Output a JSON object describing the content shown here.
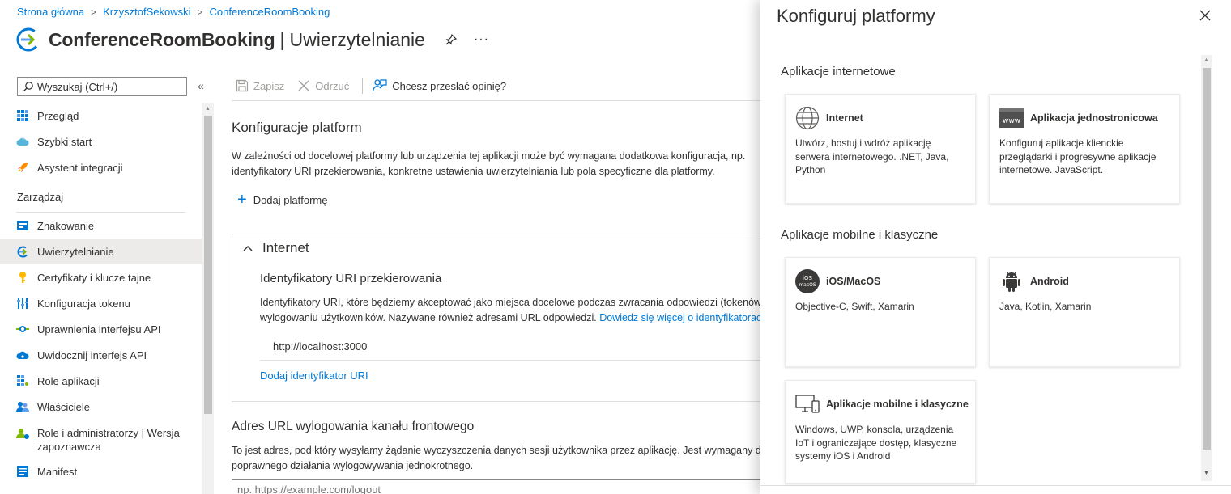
{
  "breadcrumb": [
    "Strona główna",
    "KrzysztofSekowski",
    "ConferenceRoomBooking"
  ],
  "header": {
    "app_name": "ConferenceRoomBooking",
    "separator": "|",
    "page": "Uwierzytelnianie",
    "more": "···"
  },
  "sidebar": {
    "search_placeholder": "Wyszukaj (Ctrl+/)",
    "collapse": "«",
    "items": [
      {
        "label": "Przegląd",
        "icon": "overview-icon"
      },
      {
        "label": "Szybki start",
        "icon": "cloud-icon"
      },
      {
        "label": "Asystent integracji",
        "icon": "rocket-icon"
      }
    ],
    "section": "Zarządzaj",
    "manage": [
      {
        "label": "Znakowanie",
        "icon": "branding-icon"
      },
      {
        "label": "Uwierzytelnianie",
        "icon": "auth-icon",
        "active": true
      },
      {
        "label": "Certyfikaty i klucze tajne",
        "icon": "key-icon"
      },
      {
        "label": "Konfiguracja tokenu",
        "icon": "token-icon"
      },
      {
        "label": "Uprawnienia interfejsu API",
        "icon": "api-permissions-icon"
      },
      {
        "label": "Uwidocznij interfejs API",
        "icon": "expose-api-icon"
      },
      {
        "label": "Role aplikacji",
        "icon": "app-roles-icon"
      },
      {
        "label": "Właściciele",
        "icon": "owners-icon"
      },
      {
        "label": "Role i administratorzy | Wersja zapoznawcza",
        "icon": "roles-admins-icon"
      },
      {
        "label": "Manifest",
        "icon": "manifest-icon"
      }
    ]
  },
  "toolbar": {
    "save": "Zapisz",
    "discard": "Odrzuć",
    "feedback": "Chcesz przesłać opinię?"
  },
  "main": {
    "platforms_title": "Konfiguracje platform",
    "platforms_desc_1": "W zależności od docelowej platformy lub urządzenia tej aplikacji może być wymagana dodatkowa konfiguracja, np.",
    "platforms_desc_2": "identyfikatory URI przekierowania, konkretne ustawienia uwierzytelniania lub pola specyficzne dla platformy.",
    "add_platform": "Dodaj platformę",
    "web_card": {
      "title": "Internet",
      "redirect_title": "Identyfikatory URI przekierowania",
      "redirect_desc_1": "Identyfikatory URI, które będziemy akceptować jako miejsca docelowe podczas zwracania odpowiedzi (tokenów) po",
      "redirect_desc_2": "wylogowaniu użytkowników. Nazywane również adresami URL odpowiedzi.",
      "learn_more": "Dowiedz się więcej o identyfikatorach URI przekierowania",
      "uri": "http://localhost:3000",
      "add_uri": "Dodaj identyfikator URI"
    },
    "logout_title": "Adres URL wylogowania kanału frontowego",
    "logout_desc_1": "To jest adres, pod który wysyłamy żądanie wyczyszczenia danych sesji użytkownika przez aplikację. Jest wymagany do",
    "logout_desc_2": "poprawnego działania wylogowywania jednokrotnego.",
    "logout_placeholder": "np. https://example.com/logout"
  },
  "panel": {
    "title": "Konfiguruj platformy",
    "web_group": "Aplikacje internetowe",
    "mobile_group": "Aplikacje mobilne i klasyczne",
    "tiles": {
      "web": {
        "name": "Internet",
        "desc": "Utwórz, hostuj i wdróż aplikację serwera internetowego. .NET, Java, Python",
        "icon": "globe-icon"
      },
      "spa": {
        "name": "Aplikacja jednostronicowa",
        "desc": "Konfiguruj aplikacje klienckie przeglądarki i progresywne aplikacje internetowe. JavaScript.",
        "icon": "www-icon",
        "icon_text": "www"
      },
      "ios": {
        "name": "iOS/MacOS",
        "desc": "Objective-C, Swift, Xamarin",
        "icon": "ios-macos-icon",
        "icon_text_1": "iOS",
        "icon_text_2": "macOS"
      },
      "android": {
        "name": "Android",
        "desc": "Java, Kotlin, Xamarin",
        "icon": "android-icon"
      },
      "desktop": {
        "name": "Aplikacje mobilne i klasyczne",
        "desc": "Windows, UWP, konsola, urządzenia IoT i ograniczające dostęp, klasyczne systemy iOS i Android",
        "icon": "desktop-icon"
      }
    }
  },
  "colors": {
    "accent": "#0078d4",
    "text": "#323130",
    "active_bg": "#edebe9",
    "border": "#e1dfdd"
  }
}
